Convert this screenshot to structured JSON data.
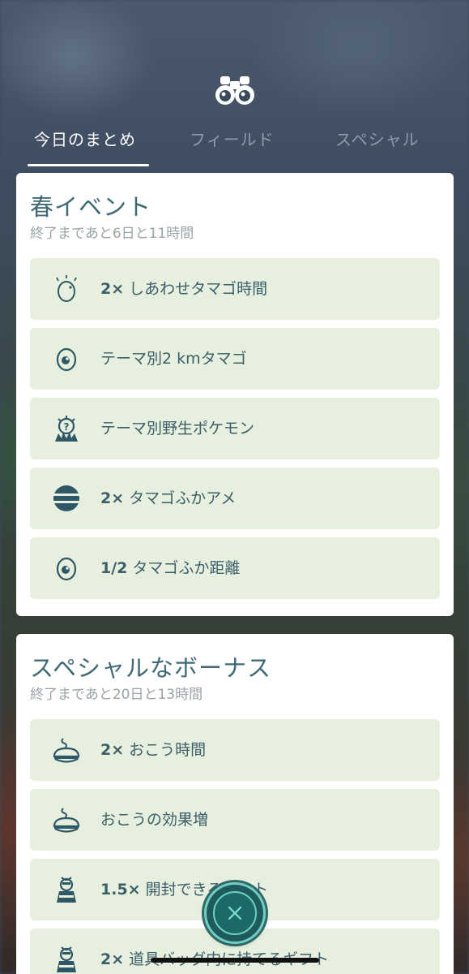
{
  "header": {
    "icon": "binoculars-icon"
  },
  "tabs": [
    {
      "label": "今日のまとめ",
      "active": true
    },
    {
      "label": "フィールド",
      "active": false
    },
    {
      "label": "スペシャル",
      "active": false
    }
  ],
  "cards": [
    {
      "title": "春イベント",
      "subtitle": "終了まであと6日と11時間",
      "bonuses": [
        {
          "icon": "egg-sparkle-icon",
          "label_bold": "2×",
          "label": " しあわせタマゴ時間"
        },
        {
          "icon": "egg-icon",
          "label_bold": "",
          "label": "テーマ別2 kmタマゴ"
        },
        {
          "icon": "wild-pokemon-icon",
          "label_bold": "",
          "label": "テーマ別野生ポケモン"
        },
        {
          "icon": "candy-icon",
          "label_bold": "2×",
          "label": " タマゴふかアメ"
        },
        {
          "icon": "egg-icon",
          "label_bold": "1/2",
          "label": " タマゴふか距離"
        }
      ]
    },
    {
      "title": "スペシャルなボーナス",
      "subtitle": "終了まであと20日と13時間",
      "bonuses": [
        {
          "icon": "incense-icon",
          "label_bold": "2×",
          "label": " おこう時間"
        },
        {
          "icon": "incense-icon",
          "label_bold": "",
          "label": "おこうの効果増"
        },
        {
          "icon": "gift-icon",
          "label_bold": "1.5×",
          "label": " 開封できるギフト"
        },
        {
          "icon": "gift-icon",
          "label_bold": "2×",
          "label": " 道具バッグ内に持てるギフト"
        }
      ]
    }
  ],
  "close_button": {
    "icon": "close-icon"
  },
  "colors": {
    "card_bg": "#ffffff",
    "bonus_bg": "#e7efdf",
    "title": "#3f6a74",
    "icon": "#2f5866",
    "accent": "#6fd0c2"
  }
}
